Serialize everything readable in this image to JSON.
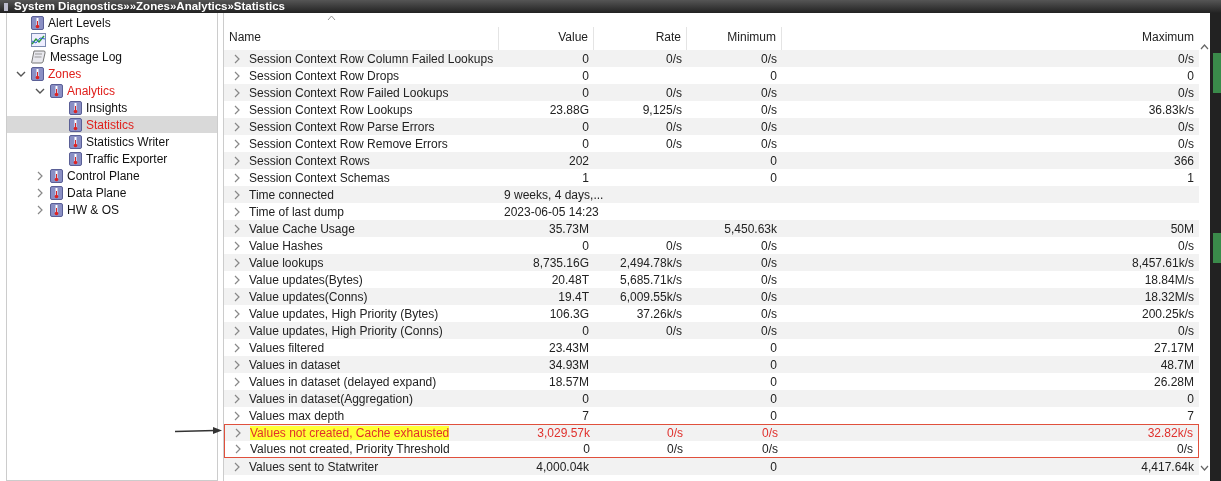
{
  "window": {
    "title": "System Diagnostics»»Zones»Analytics»Statistics"
  },
  "tree": [
    {
      "label": "Alert Levels",
      "kind": "thermo",
      "selected": false,
      "on_path": false
    },
    {
      "label": "Graphs",
      "kind": "graph",
      "selected": false,
      "on_path": false
    },
    {
      "label": "Message Log",
      "kind": "scroll",
      "selected": false,
      "on_path": false
    },
    {
      "label": "Zones",
      "kind": "thermo",
      "selected": false,
      "on_path": true,
      "expanded": true,
      "children": [
        {
          "label": "Analytics",
          "kind": "thermo",
          "selected": false,
          "on_path": true,
          "expanded": true,
          "children": [
            {
              "label": "Insights",
              "kind": "thermo",
              "selected": false,
              "on_path": false
            },
            {
              "label": "Statistics",
              "kind": "thermo",
              "selected": true,
              "on_path": true
            },
            {
              "label": "Statistics Writer",
              "kind": "thermo",
              "selected": false,
              "on_path": false
            },
            {
              "label": "Traffic Exporter",
              "kind": "thermo",
              "selected": false,
              "on_path": false
            }
          ]
        },
        {
          "label": "Control Plane",
          "kind": "thermo",
          "selected": false,
          "on_path": false,
          "expanded": false
        },
        {
          "label": "Data Plane",
          "kind": "thermo",
          "selected": false,
          "on_path": false,
          "expanded": false
        },
        {
          "label": "HW & OS",
          "kind": "thermo",
          "selected": false,
          "on_path": false,
          "expanded": false
        }
      ]
    }
  ],
  "table": {
    "columns": [
      "Name",
      "Value",
      "Rate",
      "Minimum",
      "Maximum"
    ],
    "rows": [
      {
        "name": "Session Context Row Column Failed Lookups",
        "value": "0",
        "rate": "0/s",
        "minimum": "0/s",
        "maximum": "0/s",
        "flagged": false,
        "boxed": false
      },
      {
        "name": "Session Context Row Drops",
        "value": "0",
        "rate": "",
        "minimum": "0",
        "maximum": "0",
        "flagged": false,
        "boxed": false
      },
      {
        "name": "Session Context Row Failed Lookups",
        "value": "0",
        "rate": "0/s",
        "minimum": "0/s",
        "maximum": "0/s",
        "flagged": false,
        "boxed": false
      },
      {
        "name": "Session Context Row Lookups",
        "value": "23.88G",
        "rate": "9,125/s",
        "minimum": "0/s",
        "maximum": "36.83k/s",
        "flagged": false,
        "boxed": false
      },
      {
        "name": "Session Context Row Parse Errors",
        "value": "0",
        "rate": "0/s",
        "minimum": "0/s",
        "maximum": "0/s",
        "flagged": false,
        "boxed": false
      },
      {
        "name": "Session Context Row Remove Errors",
        "value": "0",
        "rate": "0/s",
        "minimum": "0/s",
        "maximum": "0/s",
        "flagged": false,
        "boxed": false
      },
      {
        "name": "Session Context Rows",
        "value": "202",
        "rate": "",
        "minimum": "0",
        "maximum": "366",
        "flagged": false,
        "boxed": false
      },
      {
        "name": "Session Context Schemas",
        "value": "1",
        "rate": "",
        "minimum": "0",
        "maximum": "1",
        "flagged": false,
        "boxed": false
      },
      {
        "name": "Time connected",
        "value": "9 weeks, 4 days,...",
        "rate": "",
        "minimum": "",
        "maximum": "",
        "flagged": false,
        "boxed": false
      },
      {
        "name": "Time of last dump",
        "value": "2023-06-05 14:23",
        "rate": "",
        "minimum": "",
        "maximum": "",
        "flagged": false,
        "boxed": false
      },
      {
        "name": "Value Cache Usage",
        "value": "35.73M",
        "rate": "",
        "minimum": "5,450.63k",
        "maximum": "50M",
        "flagged": false,
        "boxed": false
      },
      {
        "name": "Value Hashes",
        "value": "0",
        "rate": "0/s",
        "minimum": "0/s",
        "maximum": "0/s",
        "flagged": false,
        "boxed": false
      },
      {
        "name": "Value lookups",
        "value": "8,735.16G",
        "rate": "2,494.78k/s",
        "minimum": "0/s",
        "maximum": "8,457.61k/s",
        "flagged": false,
        "boxed": false
      },
      {
        "name": "Value updates(Bytes)",
        "value": "20.48T",
        "rate": "5,685.71k/s",
        "minimum": "0/s",
        "maximum": "18.84M/s",
        "flagged": false,
        "boxed": false
      },
      {
        "name": "Value updates(Conns)",
        "value": "19.4T",
        "rate": "6,009.55k/s",
        "minimum": "0/s",
        "maximum": "18.32M/s",
        "flagged": false,
        "boxed": false
      },
      {
        "name": "Value updates, High Priority (Bytes)",
        "value": "106.3G",
        "rate": "37.26k/s",
        "minimum": "0/s",
        "maximum": "200.25k/s",
        "flagged": false,
        "boxed": false
      },
      {
        "name": "Value updates, High Priority (Conns)",
        "value": "0",
        "rate": "0/s",
        "minimum": "0/s",
        "maximum": "0/s",
        "flagged": false,
        "boxed": false
      },
      {
        "name": "Values filtered",
        "value": "23.43M",
        "rate": "",
        "minimum": "0",
        "maximum": "27.17M",
        "flagged": false,
        "boxed": false
      },
      {
        "name": "Values in dataset",
        "value": "34.93M",
        "rate": "",
        "minimum": "0",
        "maximum": "48.7M",
        "flagged": false,
        "boxed": false
      },
      {
        "name": "Values in dataset (delayed expand)",
        "value": "18.57M",
        "rate": "",
        "minimum": "0",
        "maximum": "26.28M",
        "flagged": false,
        "boxed": false
      },
      {
        "name": "Values in dataset(Aggregation)",
        "value": "0",
        "rate": "",
        "minimum": "0",
        "maximum": "0",
        "flagged": false,
        "boxed": false
      },
      {
        "name": "Values max depth",
        "value": "7",
        "rate": "",
        "minimum": "0",
        "maximum": "7",
        "flagged": false,
        "boxed": false
      },
      {
        "name": "Values not created, Cache exhausted",
        "value": "3,029.57k",
        "rate": "0/s",
        "minimum": "0/s",
        "maximum": "32.82k/s",
        "flagged": true,
        "boxed": true
      },
      {
        "name": "Values not created, Priority Threshold",
        "value": "0",
        "rate": "0/s",
        "minimum": "0/s",
        "maximum": "0/s",
        "flagged": false,
        "boxed": true
      },
      {
        "name": "Values sent to Statwriter",
        "value": "4,000.04k",
        "rate": "",
        "minimum": "0",
        "maximum": "4,417.64k",
        "flagged": false,
        "boxed": false
      }
    ]
  }
}
